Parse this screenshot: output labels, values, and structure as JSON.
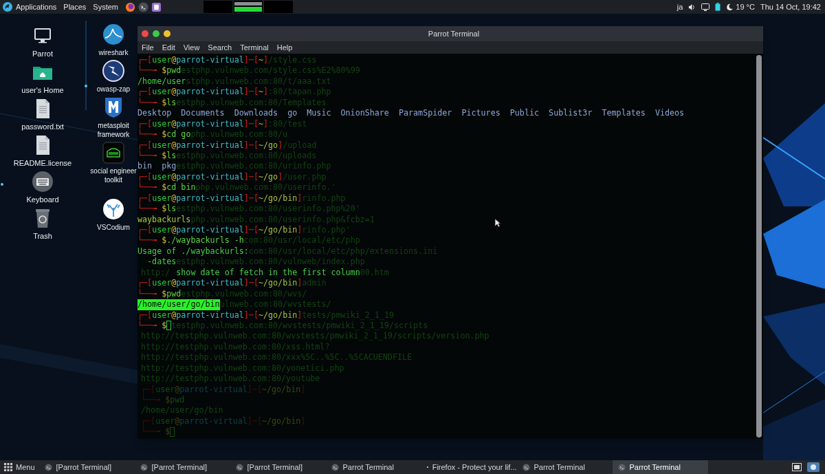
{
  "top_panel": {
    "menus": [
      "Applications",
      "Places",
      "System"
    ],
    "keyboard_layout": "ja",
    "temperature": "19 °C",
    "clock": "Thu 14 Oct, 19:42"
  },
  "desktop_columns": [
    [
      {
        "label": "Parrot",
        "kind": "monitor"
      },
      {
        "label": "user's Home",
        "kind": "folder"
      },
      {
        "label": "password.txt",
        "kind": "document"
      },
      {
        "label": "README.license",
        "kind": "document"
      },
      {
        "label": "Keyboard",
        "kind": "keyboard"
      },
      {
        "label": "Trash",
        "kind": "trash"
      }
    ],
    [
      {
        "label": "wireshark",
        "kind": "fin"
      },
      {
        "label": "owasp-zap",
        "kind": "bolt"
      },
      {
        "label": "metasploit framework",
        "kind": "shield"
      },
      {
        "label": "social engineer toolkit",
        "kind": "toolkit"
      },
      {
        "label": "VSCodium",
        "kind": "coral"
      }
    ]
  ],
  "terminal": {
    "title": "Parrot Terminal",
    "menu": [
      "File",
      "Edit",
      "View",
      "Search",
      "Terminal",
      "Help"
    ],
    "lines": [
      {
        "kind": "prompt",
        "parts": [
          "┌─[",
          "user",
          "@",
          "parrot-virtual",
          "]─[",
          "~",
          "]"
        ],
        "ghost": "/style.css"
      },
      {
        "kind": "command",
        "parts": [
          "└──╼ ",
          "$",
          "pwd"
        ],
        "cursor": false,
        "ghost": "estphp.vulnweb.com/style.css%E2%80%99"
      },
      {
        "kind": "output",
        "text": "/home/user",
        "ghost": "stphp.vulnweb.com:80/t/aaa.txt"
      },
      {
        "kind": "prompt",
        "parts": [
          "┌─[",
          "user",
          "@",
          "parrot-virtual",
          "]─[",
          "~",
          "]"
        ],
        "ghost": ":80/tapan.php"
      },
      {
        "kind": "command",
        "parts": [
          "└──╼ ",
          "$",
          "ls"
        ],
        "cursor": false,
        "ghost": "estphp.vulnweb.com:80/Templates"
      },
      {
        "kind": "listing",
        "items": [
          "Desktop",
          "Documents",
          "Downloads",
          "go",
          "Music",
          "OnionShare",
          "ParamSpider",
          "Pictures",
          "Public",
          "Sublist3r",
          "Templates",
          "Videos"
        ]
      },
      {
        "kind": "prompt",
        "parts": [
          "┌─[",
          "user",
          "@",
          "parrot-virtual",
          "]─[",
          "~",
          "]"
        ],
        "ghost": ":80/test"
      },
      {
        "kind": "command",
        "parts": [
          "└──╼ ",
          "$",
          "cd go"
        ],
        "cursor": false,
        "ghost": "php.vulnweb.com:80/u"
      },
      {
        "kind": "prompt",
        "parts": [
          "┌─[",
          "user",
          "@",
          "parrot-virtual",
          "]─[",
          "~/go",
          "]"
        ],
        "ghost": "/upload"
      },
      {
        "kind": "command",
        "parts": [
          "└──╼ ",
          "$",
          "ls"
        ],
        "cursor": false,
        "ghost": "estphp.vulnweb.com:80/uploads"
      },
      {
        "kind": "listing",
        "items": [
          "bin",
          "pkg"
        ],
        "ghost": "estphp.vulnweb.com:80/urinfo.php"
      },
      {
        "kind": "prompt",
        "parts": [
          "┌─[",
          "user",
          "@",
          "parrot-virtual",
          "]─[",
          "~/go",
          "]"
        ],
        "ghost": "/user.php"
      },
      {
        "kind": "command",
        "parts": [
          "└──╼ ",
          "$",
          "cd bin"
        ],
        "cursor": false,
        "ghost": "php.vulnweb.com:80/userinfo.'"
      },
      {
        "kind": "prompt",
        "parts": [
          "┌─[",
          "user",
          "@",
          "parrot-virtual",
          "]─[",
          "~/go/bin",
          "]"
        ],
        "ghost": "rinfo.php"
      },
      {
        "kind": "command",
        "parts": [
          "└──╼ ",
          "$",
          "ls"
        ],
        "cursor": false,
        "ghost": "estphp.vulnweb.com:80/userinfo.php%20'"
      },
      {
        "kind": "file",
        "text": "waybackurls",
        "ghost": "php.vulnweb.com:80/userinfo.php&fcbz=1"
      },
      {
        "kind": "prompt",
        "parts": [
          "┌─[",
          "user",
          "@",
          "parrot-virtual",
          "]─[",
          "~/go/bin",
          "]"
        ],
        "ghost": "rinfo.php'"
      },
      {
        "kind": "command",
        "parts": [
          "└──╼ ",
          "$",
          "./waybackurls -h"
        ],
        "cursor": false,
        "ghost": "com:80/usr/local/etc/php"
      },
      {
        "kind": "output",
        "text": "Usage of ./waybackurls:",
        "ghost": "com:80/usr/local/etc/php/extensions.ini"
      },
      {
        "kind": "option",
        "text": "-dates",
        "ghost": "estphp.vulnweb.com:80/vulnweb/index.php"
      },
      {
        "kind": "option_help",
        "text": "show date of fetch in the first column",
        "ghost_before": "http:/",
        "ghost": "00.htm"
      },
      {
        "kind": "prompt",
        "parts": [
          "┌─[",
          "user",
          "@",
          "parrot-virtual",
          "]─[",
          "~/go/bin",
          "]"
        ],
        "ghost": "admin"
      },
      {
        "kind": "command",
        "parts": [
          "└──╼ ",
          "$",
          "pwd"
        ],
        "cursor": false,
        "ghost": "estphp.vulnweb.com:80/wvs/"
      },
      {
        "kind": "selection",
        "text": "/home/user/go/bin",
        "ghost": "ulnweb.com:80/wvstests/"
      },
      {
        "kind": "prompt",
        "parts": [
          "┌─[",
          "user",
          "@",
          "parrot-virtual",
          "]─[",
          "~/go/bin",
          "]"
        ],
        "ghost": "tests/pmwiki_2_1_19"
      },
      {
        "kind": "command",
        "parts": [
          "└──╼ ",
          "$"
        ],
        "cursor": true,
        "ghost": "testphp.vulnweb.com:80/wvstests/pmwiki_2_1_19/scripts"
      },
      {
        "kind": "faded",
        "text": "http://testphp.vulnweb.com:80/wvstests/pmwiki_2_1_19/scripts/version.php"
      },
      {
        "kind": "faded",
        "text": "http://testphp.vulnweb.com:80/xss.html?"
      },
      {
        "kind": "faded",
        "text": "http://testphp.vulnweb.com:80/xxx%5C..%5C..%5CACUENDFILE"
      },
      {
        "kind": "faded",
        "text": "http://testphp.vulnweb.com:80/yonetici.php"
      },
      {
        "kind": "faded",
        "text": "http://testphp.vulnweb.com:80/youtube"
      },
      {
        "kind": "faded_prompt",
        "parts": [
          "┌─[",
          "user",
          "@",
          "parrot-virtual",
          "]─[",
          "~/go/bin",
          "]"
        ]
      },
      {
        "kind": "faded_command",
        "parts": [
          "└──╼ ",
          "$",
          "pwd"
        ],
        "cursor": false
      },
      {
        "kind": "faded",
        "text": "/home/user/go/bin"
      },
      {
        "kind": "faded_prompt",
        "parts": [
          "┌─[",
          "user",
          "@",
          "parrot-virtual",
          "]─[",
          "~/go/bin",
          "]"
        ]
      },
      {
        "kind": "faded_command",
        "parts": [
          "└──╼ ",
          "$"
        ],
        "cursor": true
      }
    ]
  },
  "taskbar": {
    "menu": "Menu",
    "tasks": [
      {
        "label": "[Parrot Terminal]",
        "kind": "terminal",
        "selected": false
      },
      {
        "label": "[Parrot Terminal]",
        "kind": "terminal",
        "selected": false
      },
      {
        "label": "[Parrot Terminal]",
        "kind": "terminal",
        "selected": false
      },
      {
        "label": "Parrot Terminal",
        "kind": "terminal",
        "selected": false
      },
      {
        "label": "Firefox - Protect your lif...",
        "kind": "browser",
        "selected": false
      },
      {
        "label": "Parrot Terminal",
        "kind": "terminal",
        "selected": false
      },
      {
        "label": "Parrot Terminal",
        "kind": "terminal",
        "selected": true
      }
    ]
  }
}
